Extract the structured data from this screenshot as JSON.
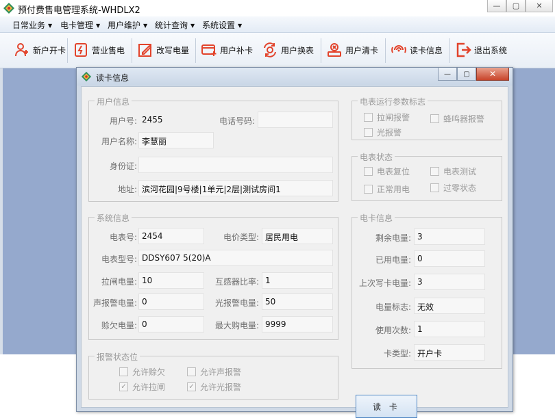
{
  "app": {
    "title": "预付费售电管理系统-WHDLX2",
    "window_buttons": [
      "—",
      "▢",
      "✕"
    ]
  },
  "menu": [
    {
      "label": "日常业务"
    },
    {
      "label": "电卡管理"
    },
    {
      "label": "用户维护"
    },
    {
      "label": "统计查询"
    },
    {
      "label": "系统设置"
    }
  ],
  "toolbar": [
    {
      "label": "新户开卡",
      "icon": "new-user-icon"
    },
    {
      "label": "营业售电",
      "icon": "sell-power-icon"
    },
    {
      "label": "改写电量",
      "icon": "edit-power-icon"
    },
    {
      "label": "用户补卡",
      "icon": "reissue-card-icon"
    },
    {
      "label": "用户换表",
      "icon": "swap-meter-icon"
    },
    {
      "label": "用户清卡",
      "icon": "clear-card-icon"
    },
    {
      "label": "读卡信息",
      "icon": "read-card-icon"
    },
    {
      "label": "退出系统",
      "icon": "exit-icon"
    }
  ],
  "dialog": {
    "title": "读卡信息",
    "buttons": [
      "—",
      "▢",
      "✕"
    ],
    "user_info": {
      "legend": "用户信息",
      "user_no_label": "用户号:",
      "user_no": "2455",
      "phone_label": "电话号码:",
      "phone": "",
      "name_label": "用户名称:",
      "name": "李慧丽",
      "id_label": "身份证:",
      "id": "",
      "address_label": "地址:",
      "address": "滨河花园|9号楼|1单元|2层|测试房间1"
    },
    "system_info": {
      "legend": "系统信息",
      "meter_no_label": "电表号:",
      "meter_no": "2454",
      "price_type_label": "电价类型:",
      "price_type": "居民用电",
      "meter_model_label": "电表型号:",
      "meter_model": "DDSY607 5(20)A",
      "trip_power_label": "拉闸电量:",
      "trip_power": "10",
      "ct_ratio_label": "互感器比率:",
      "ct_ratio": "1",
      "sound_alarm_label": "声报警电量:",
      "sound_alarm": "0",
      "light_alarm_label": "光报警电量:",
      "light_alarm": "50",
      "credit_label": "赊欠电量:",
      "credit": "0",
      "max_buy_label": "最大购电量:",
      "max_buy": "9999"
    },
    "alarm_status": {
      "legend": "报警状态位",
      "allow_credit": {
        "label": "允许赊欠",
        "checked": false
      },
      "allow_sound": {
        "label": "允许声报警",
        "checked": false
      },
      "allow_trip": {
        "label": "允许拉闸",
        "checked": true
      },
      "allow_light": {
        "label": "允许光报警",
        "checked": true
      }
    },
    "run_params": {
      "legend": "电表运行参数标志",
      "trip_alarm": {
        "label": "拉闸报警",
        "checked": false
      },
      "buzzer_alarm": {
        "label": "蜂鸣器报警",
        "checked": false
      },
      "light_alarm": {
        "label": "光报警",
        "checked": false
      }
    },
    "meter_status": {
      "legend": "电表状态",
      "reset": {
        "label": "电表复位",
        "checked": false
      },
      "test": {
        "label": "电表测试",
        "checked": false
      },
      "normal": {
        "label": "正常用电",
        "checked": false
      },
      "zero": {
        "label": "过零状态",
        "checked": false
      }
    },
    "card_info": {
      "legend": "电卡信息",
      "remaining_label": "剩余电量:",
      "remaining": "3",
      "used_label": "已用电量:",
      "used": "0",
      "last_write_label": "上次写卡电量:",
      "last_write": "3",
      "power_flag_label": "电量标志:",
      "power_flag": "无效",
      "use_count_label": "使用次数:",
      "use_count": "1",
      "card_type_label": "卡类型:",
      "card_type": "开户卡"
    },
    "read_button": "读 卡"
  },
  "colors": {
    "workspace": "#95a9cd",
    "dialog_frame": "#cfd9e6",
    "accent_red": "#e2432b",
    "accent_blue": "#4d84c2"
  }
}
